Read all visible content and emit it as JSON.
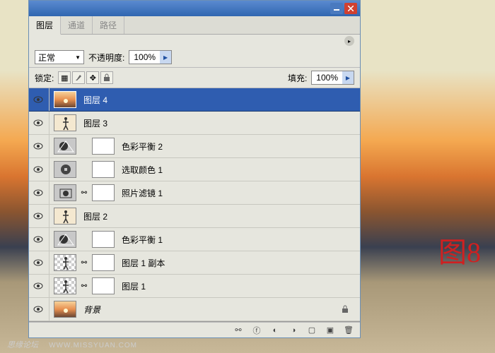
{
  "tabs": {
    "layers": "图层",
    "channels": "通道",
    "paths": "路径"
  },
  "toolbar": {
    "blend_mode": "正常",
    "opacity_label": "不透明度:",
    "opacity_value": "100%",
    "lock_label": "锁定:",
    "fill_label": "填充:",
    "fill_value": "100%"
  },
  "layers": [
    {
      "name": "图层 4",
      "visible": true,
      "selected": true,
      "type": "image",
      "thumb": "sunset1"
    },
    {
      "name": "图层 3",
      "visible": true,
      "type": "image",
      "thumb": "figure1"
    },
    {
      "name": "色彩平衡 2",
      "visible": true,
      "type": "adjustment",
      "icon": "color-balance",
      "mask": true
    },
    {
      "name": "选取颜色 1",
      "visible": true,
      "type": "adjustment",
      "icon": "selective-color",
      "mask": true
    },
    {
      "name": "照片滤镜 1",
      "visible": true,
      "type": "adjustment",
      "icon": "photo-filter",
      "mask": true,
      "linked": true
    },
    {
      "name": "图层 2",
      "visible": true,
      "type": "image",
      "thumb": "figure2"
    },
    {
      "name": "色彩平衡 1",
      "visible": true,
      "type": "adjustment",
      "icon": "color-balance",
      "mask": true
    },
    {
      "name": "图层 1 副本",
      "visible": true,
      "type": "image",
      "thumb": "figure-trans",
      "checker": true,
      "linked": true,
      "mask": true
    },
    {
      "name": "图层 1",
      "visible": true,
      "type": "image",
      "thumb": "figure-trans",
      "checker": true,
      "linked": true,
      "mask": true
    },
    {
      "name": "背景",
      "visible": true,
      "type": "image",
      "thumb": "sunset2",
      "locked": true,
      "italic": true
    }
  ],
  "annotation": "图8",
  "watermark": {
    "text": "思缘论坛",
    "url": "WWW.MISSYUAN.COM"
  }
}
